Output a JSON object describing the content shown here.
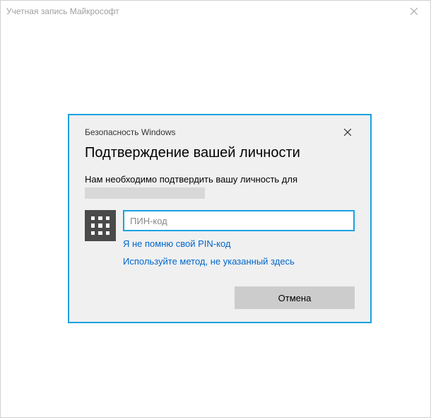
{
  "outer": {
    "title": "Учетная запись Майкрософт"
  },
  "dialog": {
    "title_small": "Безопасность Windows",
    "heading": "Подтверждение вашей личности",
    "body_text": "Нам необходимо подтвердить вашу личность для",
    "pin_placeholder": "ПИН-код",
    "forgot_pin_link": "Я не помню свой PIN-код",
    "alt_method_link": "Используйте метод, не указанный здесь",
    "cancel_label": "Отмена"
  }
}
